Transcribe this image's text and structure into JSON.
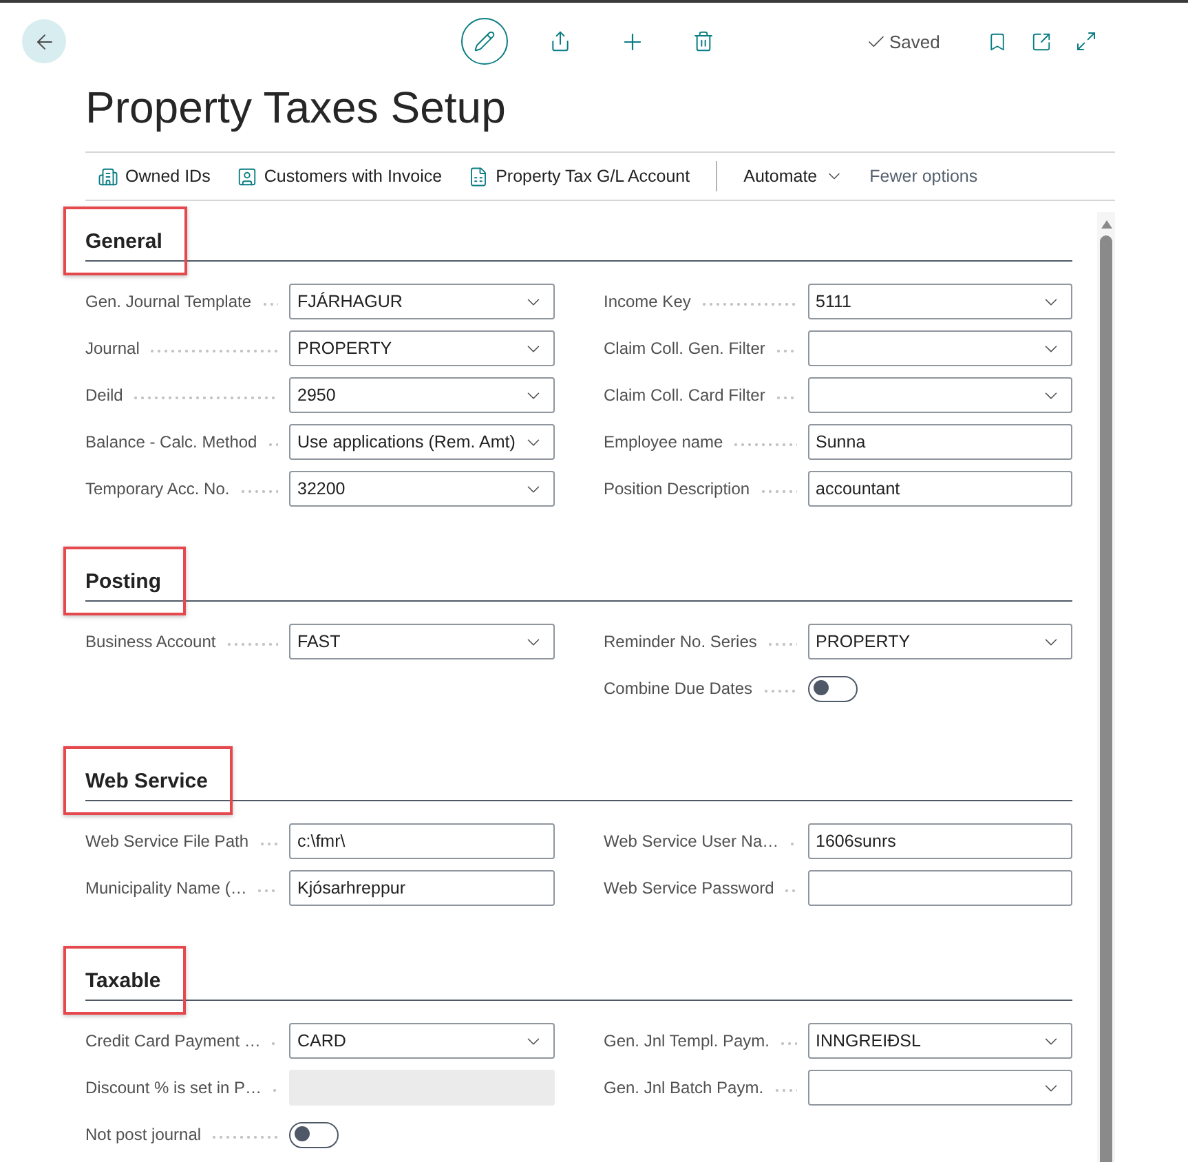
{
  "top_bar": {
    "status": "Saved"
  },
  "title": "Property Taxes Setup",
  "action_bar": {
    "actions": [
      "Owned IDs",
      "Customers with Invoice",
      "Property Tax G/L Account"
    ],
    "menu": "Automate",
    "toggle_link": "Fewer options"
  },
  "sections": [
    {
      "heading": "General",
      "highlighted": true,
      "left_fields": [
        {
          "label": "Gen. Journal Template",
          "kind": "dropdown",
          "value": "FJÁRHAGUR"
        },
        {
          "label": "Journal",
          "kind": "dropdown",
          "value": "PROPERTY"
        },
        {
          "label": "Deild",
          "kind": "dropdown",
          "value": "2950"
        },
        {
          "label": "Balance - Calc. Method",
          "kind": "dropdown",
          "value": "Use applications (Rem. Amt)"
        },
        {
          "label": "Temporary Acc. No.",
          "kind": "dropdown",
          "value": "32200"
        }
      ],
      "right_fields": [
        {
          "label": "Income Key",
          "kind": "dropdown",
          "value": "5111"
        },
        {
          "label": "Claim Coll. Gen. Filter",
          "kind": "dropdown"
        },
        {
          "label": "Claim Coll. Card Filter",
          "kind": "dropdown"
        },
        {
          "label": "Employee name",
          "kind": "text",
          "value": "Sunna"
        },
        {
          "label": "Position Description",
          "kind": "text",
          "value": "accountant"
        }
      ]
    },
    {
      "heading": "Posting",
      "highlighted": true,
      "left_fields": [
        {
          "label": "Business Account",
          "kind": "dropdown",
          "value": "FAST"
        }
      ],
      "right_fields": [
        {
          "label": "Reminder No. Series",
          "kind": "dropdown",
          "value": "PROPERTY"
        },
        {
          "label": "Combine Due Dates",
          "kind": "toggle",
          "on": false
        }
      ]
    },
    {
      "heading": "Web Service",
      "highlighted": true,
      "left_fields": [
        {
          "label": "Web Service File Path",
          "kind": "text",
          "value": "c:\\fmr\\"
        },
        {
          "label": "Municipality Name (…",
          "kind": "text",
          "value": "Kjósarhreppur"
        }
      ],
      "right_fields": [
        {
          "label": "Web Service User Na…",
          "kind": "text",
          "value": "1606sunrs"
        },
        {
          "label": "Web Service Password",
          "kind": "text"
        }
      ]
    },
    {
      "heading": "Taxable",
      "highlighted": true,
      "left_fields": [
        {
          "label": "Credit Card Payment …",
          "kind": "dropdown",
          "value": "CARD"
        },
        {
          "label": "Discount % is set in P…",
          "kind": "readonly"
        },
        {
          "label": "Not post journal",
          "kind": "toggle",
          "on": false
        }
      ],
      "right_fields": [
        {
          "label": "Gen. Jnl Templ. Paym.",
          "kind": "dropdown",
          "value": "INNGREIÐSL"
        },
        {
          "label": "Gen. Jnl Batch Paym.",
          "kind": "dropdown"
        }
      ]
    }
  ]
}
